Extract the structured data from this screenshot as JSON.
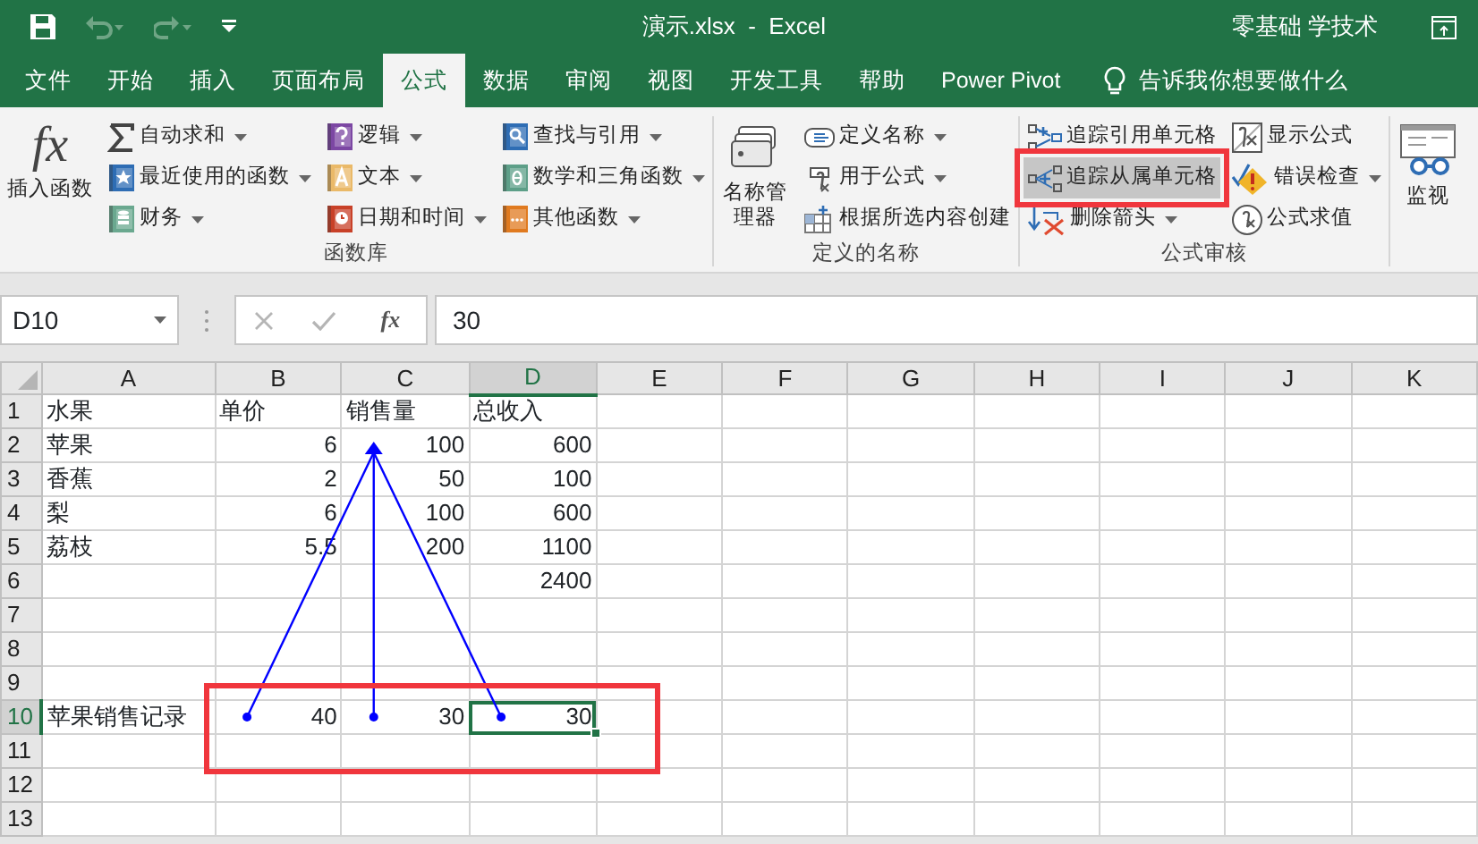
{
  "title_bar": {
    "quick_access": [
      {
        "kind": "save",
        "disabled": false
      },
      {
        "kind": "undo",
        "disabled": true
      },
      {
        "kind": "redo",
        "disabled": true
      },
      {
        "kind": "customize",
        "disabled": false
      }
    ],
    "title": "演示.xlsx  -  Excel",
    "user": "零基础 学技术"
  },
  "tabs": [
    {
      "label": "文件",
      "selected": false
    },
    {
      "label": "开始",
      "selected": false
    },
    {
      "label": "插入",
      "selected": false
    },
    {
      "label": "页面布局",
      "selected": false
    },
    {
      "label": "公式",
      "selected": true
    },
    {
      "label": "数据",
      "selected": false
    },
    {
      "label": "审阅",
      "selected": false
    },
    {
      "label": "视图",
      "selected": false
    },
    {
      "label": "开发工具",
      "selected": false
    },
    {
      "label": "帮助",
      "selected": false
    },
    {
      "label": "Power Pivot",
      "selected": false
    }
  ],
  "tell_me": "告诉我你想要做什么",
  "ribbon_groups": [
    {
      "label": "函数库",
      "columns": [
        [
          {
            "kind": "large",
            "label": "插入函数",
            "icon_text": "fx"
          }
        ],
        [
          {
            "kind": "small",
            "label": "自动求和",
            "dropdown": true,
            "pressed": false
          },
          {
            "kind": "small",
            "label": "最近使用的函数",
            "dropdown": true,
            "pressed": false
          },
          {
            "kind": "small",
            "label": "财务",
            "dropdown": true,
            "pressed": false
          }
        ],
        [
          {
            "kind": "small",
            "label": "逻辑",
            "dropdown": true,
            "pressed": false
          },
          {
            "kind": "small",
            "label": "文本",
            "dropdown": true,
            "pressed": false
          },
          {
            "kind": "small",
            "label": "日期和时间",
            "dropdown": true,
            "pressed": false
          }
        ],
        [
          {
            "kind": "small",
            "label": "查找与引用",
            "dropdown": true,
            "pressed": false
          },
          {
            "kind": "small",
            "label": "数学和三角函数",
            "dropdown": true,
            "pressed": false
          },
          {
            "kind": "small",
            "label": "其他函数",
            "dropdown": true,
            "pressed": false
          }
        ]
      ]
    },
    {
      "label": "定义的名称",
      "columns": [
        [
          {
            "kind": "large",
            "label": "名称管理器"
          }
        ],
        [
          {
            "kind": "small",
            "label": "定义名称",
            "dropdown": true,
            "pressed": false
          },
          {
            "kind": "small",
            "label": "用于公式",
            "dropdown": true,
            "pressed": false
          },
          {
            "kind": "small",
            "label": "根据所选内容创建",
            "dropdown": false,
            "pressed": false
          }
        ]
      ]
    },
    {
      "label": "公式审核",
      "columns": [
        [
          {
            "kind": "small",
            "label": "追踪引用单元格",
            "dropdown": false,
            "pressed": false,
            "outlined": false
          },
          {
            "kind": "small",
            "label": "追踪从属单元格",
            "dropdown": false,
            "pressed": true,
            "outlined": true
          },
          {
            "kind": "small",
            "label": "删除箭头",
            "dropdown": true,
            "pressed": false,
            "outlined": false
          }
        ],
        [
          {
            "kind": "small",
            "label": "显示公式",
            "dropdown": false,
            "pressed": false
          },
          {
            "kind": "small",
            "label": "错误检查",
            "dropdown": true,
            "pressed": false
          },
          {
            "kind": "small",
            "label": "公式求值",
            "dropdown": false,
            "pressed": false
          }
        ]
      ]
    },
    {
      "columns": [
        [
          {
            "kind": "large",
            "label": "监视"
          }
        ]
      ]
    }
  ],
  "formula_bar": {
    "name_box": "D10",
    "fx_button": "fx",
    "value": "30"
  },
  "sheet": {
    "columns": [
      {
        "label": "A",
        "selected": false
      },
      {
        "label": "B",
        "selected": false
      },
      {
        "label": "C",
        "selected": false
      },
      {
        "label": "D",
        "selected": true
      },
      {
        "label": "E",
        "selected": false
      },
      {
        "label": "F",
        "selected": false
      },
      {
        "label": "G",
        "selected": false
      },
      {
        "label": "H",
        "selected": false
      },
      {
        "label": "I",
        "selected": false
      },
      {
        "label": "J",
        "selected": false
      },
      {
        "label": "K",
        "selected": false
      }
    ],
    "rows": [
      {
        "header": "1",
        "selected": false,
        "cells": [
          {
            "text": "水果",
            "kind": "text"
          },
          {
            "text": "单价",
            "kind": "text"
          },
          {
            "text": "销售量",
            "kind": "text"
          },
          {
            "text": "总收入",
            "kind": "text"
          }
        ]
      },
      {
        "header": "2",
        "selected": false,
        "cells": [
          {
            "text": "苹果",
            "kind": "text"
          },
          {
            "text": "6",
            "kind": "number"
          },
          {
            "text": "100",
            "kind": "number",
            "trace_head": true
          },
          {
            "text": "600",
            "kind": "number"
          }
        ]
      },
      {
        "header": "3",
        "selected": false,
        "cells": [
          {
            "text": "香蕉",
            "kind": "text"
          },
          {
            "text": "2",
            "kind": "number"
          },
          {
            "text": "50",
            "kind": "number"
          },
          {
            "text": "100",
            "kind": "number"
          }
        ]
      },
      {
        "header": "4",
        "selected": false,
        "cells": [
          {
            "text": "梨",
            "kind": "text"
          },
          {
            "text": "6",
            "kind": "number"
          },
          {
            "text": "100",
            "kind": "number"
          },
          {
            "text": "600",
            "kind": "number"
          }
        ]
      },
      {
        "header": "5",
        "selected": false,
        "cells": [
          {
            "text": "荔枝",
            "kind": "text"
          },
          {
            "text": "5.5",
            "kind": "number"
          },
          {
            "text": "200",
            "kind": "number"
          },
          {
            "text": "1100",
            "kind": "number"
          }
        ]
      },
      {
        "header": "6",
        "selected": false,
        "cells": [
          null,
          null,
          null,
          {
            "text": "2400",
            "kind": "number"
          }
        ]
      },
      {
        "header": "7",
        "selected": false
      },
      {
        "header": "8",
        "selected": false
      },
      {
        "header": "9",
        "selected": false
      },
      {
        "header": "10",
        "selected": true,
        "outlined": true,
        "cells": [
          {
            "text": "苹果销售记录",
            "kind": "text"
          },
          {
            "text": "40",
            "kind": "number",
            "trace_tail": true
          },
          {
            "text": "30",
            "kind": "number",
            "trace_tail": true
          },
          {
            "text": "30",
            "kind": "number",
            "trace_tail": true,
            "selected": true
          }
        ]
      },
      {
        "header": "11",
        "selected": false
      },
      {
        "header": "12",
        "selected": false
      },
      {
        "header": "13",
        "selected": false
      }
    ]
  }
}
